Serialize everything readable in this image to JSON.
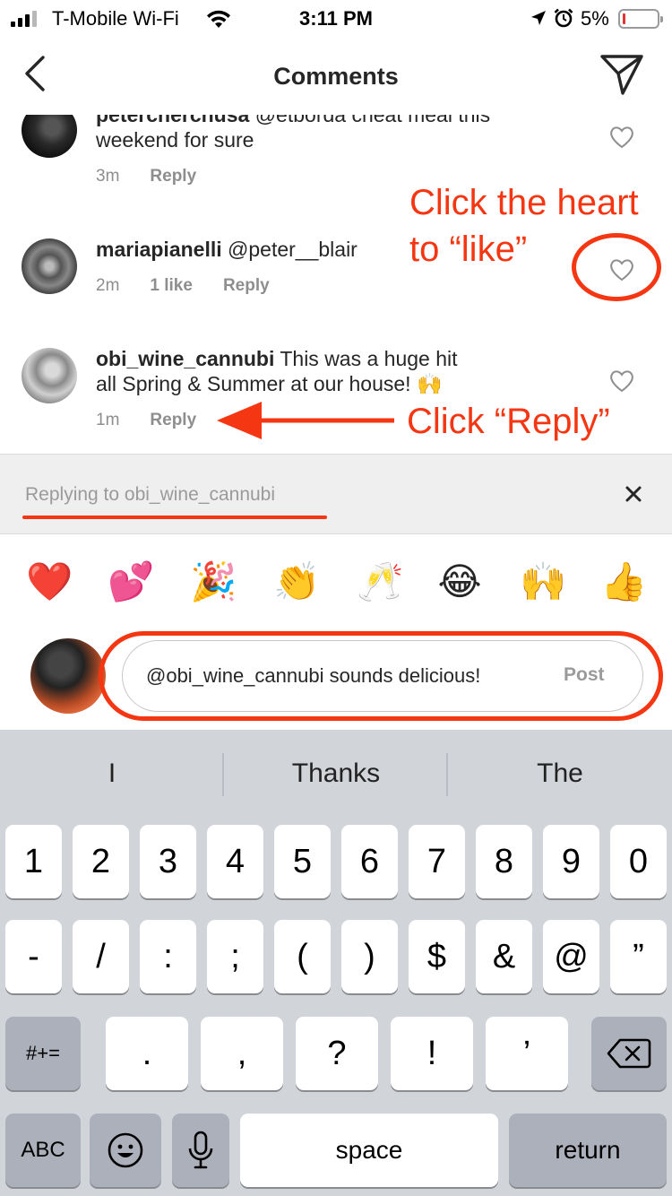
{
  "status_bar": {
    "carrier": "T-Mobile Wi-Fi",
    "time": "3:11 PM",
    "battery": "5%",
    "battery_level": 0.05,
    "battery_color": "#e33333",
    "icons": [
      "signal-icon",
      "wifi-icon",
      "location-icon",
      "alarm-icon",
      "battery-icon"
    ]
  },
  "nav": {
    "title": "Comments",
    "back_icon": "chevron-left-icon",
    "send_icon": "paper-plane-icon"
  },
  "comments": [
    {
      "username": "petercherchusa",
      "text": " @etborda cheat meal this weekend for sure",
      "time": "3m",
      "likes": "",
      "reply": "Reply"
    },
    {
      "username": "mariapianelli",
      "text": " @peter__blair",
      "time": "2m",
      "likes": "1 like",
      "reply": "Reply"
    },
    {
      "username": "obi_wine_cannubi",
      "text": " This was a huge hit all Spring & Summer at our house! 🙌",
      "time": "1m",
      "likes": "",
      "reply": "Reply"
    }
  ],
  "annotations": {
    "heart_line1": "Click the heart",
    "heart_line2": "to “like”",
    "reply": "Click “Reply”",
    "color": "#f43612"
  },
  "reply_bar": {
    "label": "Replying to obi_wine_cannubi",
    "close_icon": "close-icon"
  },
  "emoji_bar": [
    "❤️",
    "💕",
    "🎉",
    "👏",
    "🥂",
    "😂",
    "🙌",
    "👍"
  ],
  "composer": {
    "value": "@obi_wine_cannubi sounds delicious!",
    "post": "Post"
  },
  "keyboard": {
    "predictions": [
      "I",
      "Thanks",
      "The"
    ],
    "row1": [
      "1",
      "2",
      "3",
      "4",
      "5",
      "6",
      "7",
      "8",
      "9",
      "0"
    ],
    "row2": [
      "-",
      "/",
      ":",
      ";",
      "(",
      ")",
      "$",
      "&",
      "@",
      "”"
    ],
    "row3": {
      "switch": "#+=",
      "keys": [
        ".",
        ",",
        "?",
        "!",
        "’"
      ],
      "delete_icon": "backspace-icon"
    },
    "row4": {
      "abc": "ABC",
      "emoji_icon": "emoji-icon",
      "mic_icon": "microphone-icon",
      "space": "space",
      "return": "return"
    }
  },
  "colors": {
    "accent": "#f43612",
    "text": "#262626",
    "muted": "#8e8e8e",
    "keyboard_bg": "#d1d4d9"
  }
}
